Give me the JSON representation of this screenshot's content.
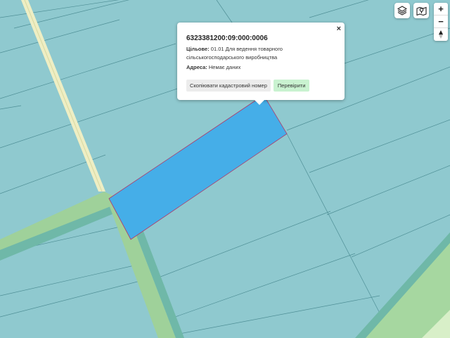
{
  "map": {
    "background_color": "#8fc9cf",
    "parcel_highlight_color": "#45aee8",
    "road_color": "#9fd19a",
    "path_color": "#f0f0c8"
  },
  "popup": {
    "close_label": "×",
    "cadastral_number": "6323381200:09:000:0006",
    "purpose_label": "Цільове:",
    "purpose_value": "01.01 Для ведення товарного сільськогосподарського виробництва",
    "address_label": "Адреса:",
    "address_value": "Немає даних",
    "copy_button": "Скопіювати кадастровий номер",
    "check_button": "Перевірити"
  },
  "controls": {
    "layers_icon": "layers-icon",
    "map_icon": "map-pin-icon",
    "zoom_in": "+",
    "zoom_out": "−",
    "compass_icon": "compass-icon"
  }
}
